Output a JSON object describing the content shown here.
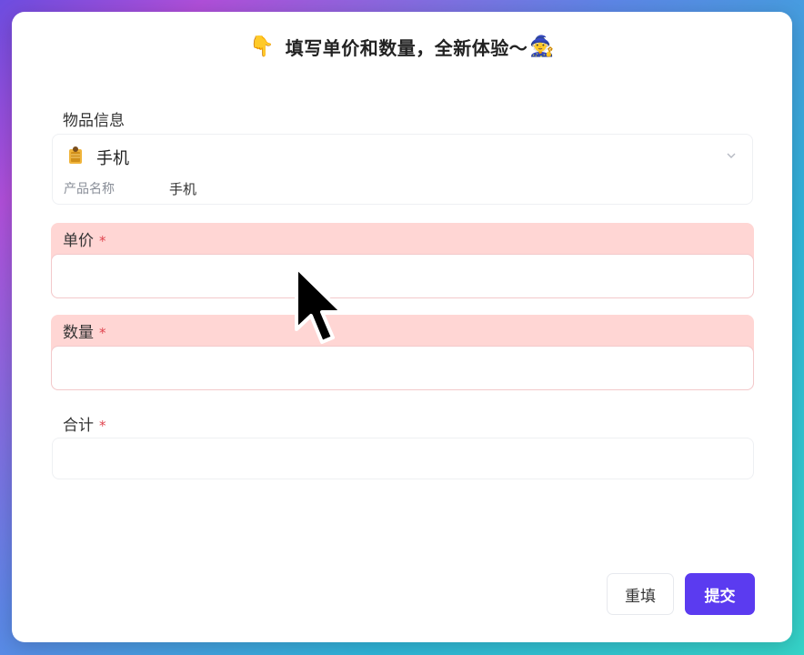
{
  "header": {
    "left_emoji": "👇",
    "title": "填写单价和数量，全新体验～",
    "right_emoji": "🧙"
  },
  "product": {
    "label": "物品信息",
    "icon": "🧧",
    "selected": "手机",
    "attr_label": "产品名称",
    "attr_value": "手机",
    "dropdown_icon": "chevron-down-icon"
  },
  "unit_price": {
    "label": "单价",
    "required_mark": "*",
    "value": ""
  },
  "quantity": {
    "label": "数量",
    "required_mark": "*",
    "value": ""
  },
  "total": {
    "label": "合计",
    "required_mark": "*",
    "value": ""
  },
  "actions": {
    "reset_label": "重填",
    "submit_label": "提交"
  },
  "colors": {
    "error_bg": "#ffd6d4",
    "required": "#e0454f",
    "primary": "#5b3bf0"
  }
}
